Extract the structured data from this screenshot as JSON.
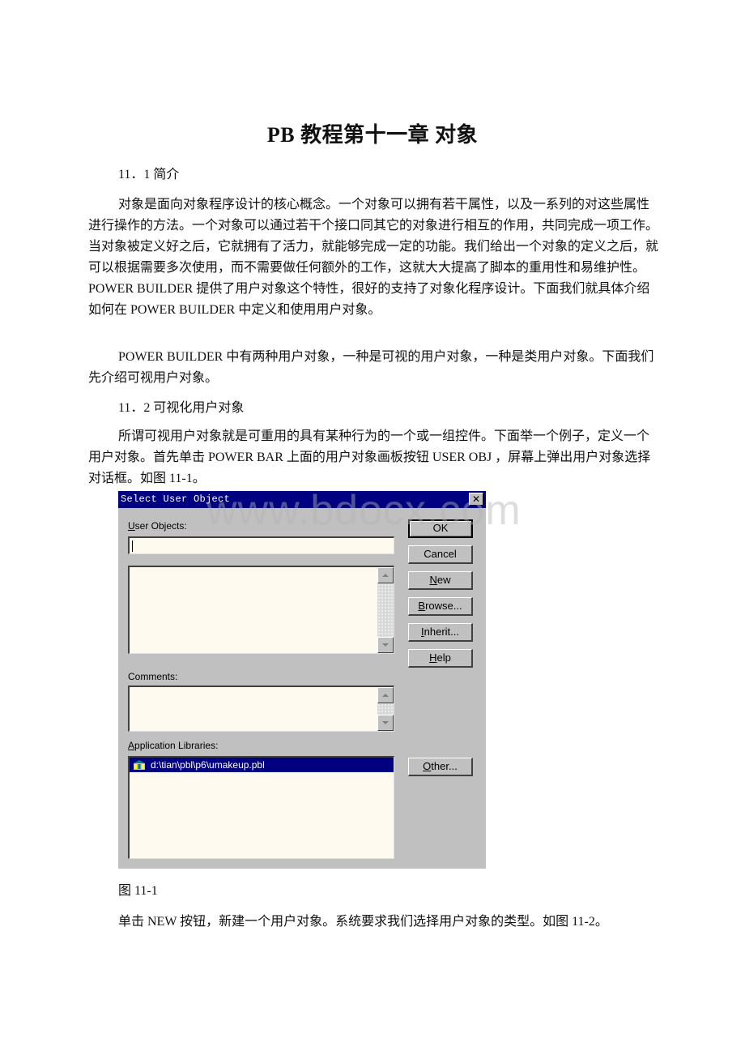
{
  "document": {
    "title": "PB 教程第十一章 对象",
    "section_1_heading": "11．1 简介",
    "para_1": "对象是面向对象程序设计的核心概念。一个对象可以拥有若干属性，以及一系列的对这些属性进行操作的方法。一个对象可以通过若干个接口同其它的对象进行相互的作用，共同完成一项工作。当对象被定义好之后，它就拥有了活力，就能够完成一定的功能。我们给出一个对象的定义之后，就可以根据需要多次使用，而不需要做任何额外的工作，这就大大提高了脚本的重用性和易维护性。POWER BUILDER 提供了用户对象这个特性，很好的支持了对象化程序设计。下面我们就具体介绍如何在 POWER BUILDER 中定义和使用用户对象。",
    "para_2": "POWER BUILDER 中有两种用户对象，一种是可视的用户对象，一种是类用户对象。下面我们先介绍可视用户对象。",
    "section_2_heading": "11．2 可视化用户对象",
    "para_3": "所谓可视用户对象就是可重用的具有某种行为的一个或一组控件。下面举一个例子，定义一个用户对象。首先单击 POWER BAR 上面的用户对象画板按钮 USER OBJ ，屏幕上弹出用户对象选择对话框。如图 11-1。",
    "figure_caption": "图 11-1",
    "para_4": "单击 NEW 按钮，新建一个用户对象。系统要求我们选择用户对象的类型。如图 11-2。",
    "watermark": "www.bdocx.com"
  },
  "dialog": {
    "title": "Select User Object",
    "close_icon": "close-x-icon",
    "user_objects_label_accel": "U",
    "user_objects_label_rest": "ser Objects:",
    "user_objects_value": "",
    "comments_label": "Comments:",
    "app_libraries_label_accel": "A",
    "app_libraries_label_rest": "pplication Libraries:",
    "libraries": [
      {
        "icon": "library-icon",
        "path": "d:\\tian\\pbl\\p6\\umakeup.pbl",
        "selected": true
      }
    ],
    "buttons": {
      "ok": "OK",
      "cancel": "Cancel",
      "new_accel": "N",
      "new_rest": "ew",
      "browse_accel": "B",
      "browse_rest": "rowse...",
      "inherit_accel": "I",
      "inherit_rest": "nherit...",
      "help_accel": "H",
      "help_rest": "elp",
      "other_accel": "O",
      "other_rest": "ther..."
    },
    "colors": {
      "titlebar": "#000080",
      "face": "#c0c0c0",
      "field": "#fffaf0",
      "selection": "#000080"
    }
  }
}
